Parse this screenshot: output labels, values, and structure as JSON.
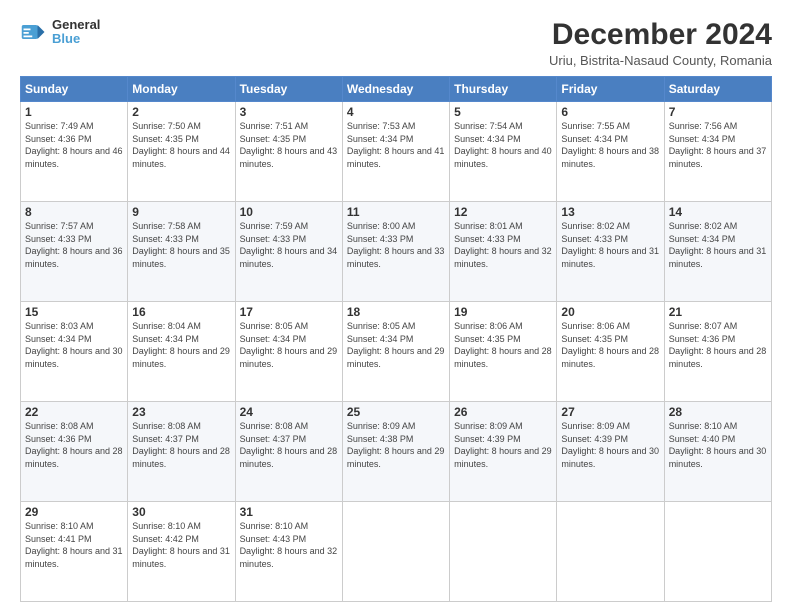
{
  "logo": {
    "line1": "General",
    "line2": "Blue"
  },
  "title": "December 2024",
  "subtitle": "Uriu, Bistrita-Nasaud County, Romania",
  "days_header": [
    "Sunday",
    "Monday",
    "Tuesday",
    "Wednesday",
    "Thursday",
    "Friday",
    "Saturday"
  ],
  "weeks": [
    [
      {
        "day": "1",
        "sunrise": "Sunrise: 7:49 AM",
        "sunset": "Sunset: 4:36 PM",
        "daylight": "Daylight: 8 hours and 46 minutes."
      },
      {
        "day": "2",
        "sunrise": "Sunrise: 7:50 AM",
        "sunset": "Sunset: 4:35 PM",
        "daylight": "Daylight: 8 hours and 44 minutes."
      },
      {
        "day": "3",
        "sunrise": "Sunrise: 7:51 AM",
        "sunset": "Sunset: 4:35 PM",
        "daylight": "Daylight: 8 hours and 43 minutes."
      },
      {
        "day": "4",
        "sunrise": "Sunrise: 7:53 AM",
        "sunset": "Sunset: 4:34 PM",
        "daylight": "Daylight: 8 hours and 41 minutes."
      },
      {
        "day": "5",
        "sunrise": "Sunrise: 7:54 AM",
        "sunset": "Sunset: 4:34 PM",
        "daylight": "Daylight: 8 hours and 40 minutes."
      },
      {
        "day": "6",
        "sunrise": "Sunrise: 7:55 AM",
        "sunset": "Sunset: 4:34 PM",
        "daylight": "Daylight: 8 hours and 38 minutes."
      },
      {
        "day": "7",
        "sunrise": "Sunrise: 7:56 AM",
        "sunset": "Sunset: 4:34 PM",
        "daylight": "Daylight: 8 hours and 37 minutes."
      }
    ],
    [
      {
        "day": "8",
        "sunrise": "Sunrise: 7:57 AM",
        "sunset": "Sunset: 4:33 PM",
        "daylight": "Daylight: 8 hours and 36 minutes."
      },
      {
        "day": "9",
        "sunrise": "Sunrise: 7:58 AM",
        "sunset": "Sunset: 4:33 PM",
        "daylight": "Daylight: 8 hours and 35 minutes."
      },
      {
        "day": "10",
        "sunrise": "Sunrise: 7:59 AM",
        "sunset": "Sunset: 4:33 PM",
        "daylight": "Daylight: 8 hours and 34 minutes."
      },
      {
        "day": "11",
        "sunrise": "Sunrise: 8:00 AM",
        "sunset": "Sunset: 4:33 PM",
        "daylight": "Daylight: 8 hours and 33 minutes."
      },
      {
        "day": "12",
        "sunrise": "Sunrise: 8:01 AM",
        "sunset": "Sunset: 4:33 PM",
        "daylight": "Daylight: 8 hours and 32 minutes."
      },
      {
        "day": "13",
        "sunrise": "Sunrise: 8:02 AM",
        "sunset": "Sunset: 4:33 PM",
        "daylight": "Daylight: 8 hours and 31 minutes."
      },
      {
        "day": "14",
        "sunrise": "Sunrise: 8:02 AM",
        "sunset": "Sunset: 4:34 PM",
        "daylight": "Daylight: 8 hours and 31 minutes."
      }
    ],
    [
      {
        "day": "15",
        "sunrise": "Sunrise: 8:03 AM",
        "sunset": "Sunset: 4:34 PM",
        "daylight": "Daylight: 8 hours and 30 minutes."
      },
      {
        "day": "16",
        "sunrise": "Sunrise: 8:04 AM",
        "sunset": "Sunset: 4:34 PM",
        "daylight": "Daylight: 8 hours and 29 minutes."
      },
      {
        "day": "17",
        "sunrise": "Sunrise: 8:05 AM",
        "sunset": "Sunset: 4:34 PM",
        "daylight": "Daylight: 8 hours and 29 minutes."
      },
      {
        "day": "18",
        "sunrise": "Sunrise: 8:05 AM",
        "sunset": "Sunset: 4:34 PM",
        "daylight": "Daylight: 8 hours and 29 minutes."
      },
      {
        "day": "19",
        "sunrise": "Sunrise: 8:06 AM",
        "sunset": "Sunset: 4:35 PM",
        "daylight": "Daylight: 8 hours and 28 minutes."
      },
      {
        "day": "20",
        "sunrise": "Sunrise: 8:06 AM",
        "sunset": "Sunset: 4:35 PM",
        "daylight": "Daylight: 8 hours and 28 minutes."
      },
      {
        "day": "21",
        "sunrise": "Sunrise: 8:07 AM",
        "sunset": "Sunset: 4:36 PM",
        "daylight": "Daylight: 8 hours and 28 minutes."
      }
    ],
    [
      {
        "day": "22",
        "sunrise": "Sunrise: 8:08 AM",
        "sunset": "Sunset: 4:36 PM",
        "daylight": "Daylight: 8 hours and 28 minutes."
      },
      {
        "day": "23",
        "sunrise": "Sunrise: 8:08 AM",
        "sunset": "Sunset: 4:37 PM",
        "daylight": "Daylight: 8 hours and 28 minutes."
      },
      {
        "day": "24",
        "sunrise": "Sunrise: 8:08 AM",
        "sunset": "Sunset: 4:37 PM",
        "daylight": "Daylight: 8 hours and 28 minutes."
      },
      {
        "day": "25",
        "sunrise": "Sunrise: 8:09 AM",
        "sunset": "Sunset: 4:38 PM",
        "daylight": "Daylight: 8 hours and 29 minutes."
      },
      {
        "day": "26",
        "sunrise": "Sunrise: 8:09 AM",
        "sunset": "Sunset: 4:39 PM",
        "daylight": "Daylight: 8 hours and 29 minutes."
      },
      {
        "day": "27",
        "sunrise": "Sunrise: 8:09 AM",
        "sunset": "Sunset: 4:39 PM",
        "daylight": "Daylight: 8 hours and 30 minutes."
      },
      {
        "day": "28",
        "sunrise": "Sunrise: 8:10 AM",
        "sunset": "Sunset: 4:40 PM",
        "daylight": "Daylight: 8 hours and 30 minutes."
      }
    ],
    [
      {
        "day": "29",
        "sunrise": "Sunrise: 8:10 AM",
        "sunset": "Sunset: 4:41 PM",
        "daylight": "Daylight: 8 hours and 31 minutes."
      },
      {
        "day": "30",
        "sunrise": "Sunrise: 8:10 AM",
        "sunset": "Sunset: 4:42 PM",
        "daylight": "Daylight: 8 hours and 31 minutes."
      },
      {
        "day": "31",
        "sunrise": "Sunrise: 8:10 AM",
        "sunset": "Sunset: 4:43 PM",
        "daylight": "Daylight: 8 hours and 32 minutes."
      },
      null,
      null,
      null,
      null
    ]
  ]
}
